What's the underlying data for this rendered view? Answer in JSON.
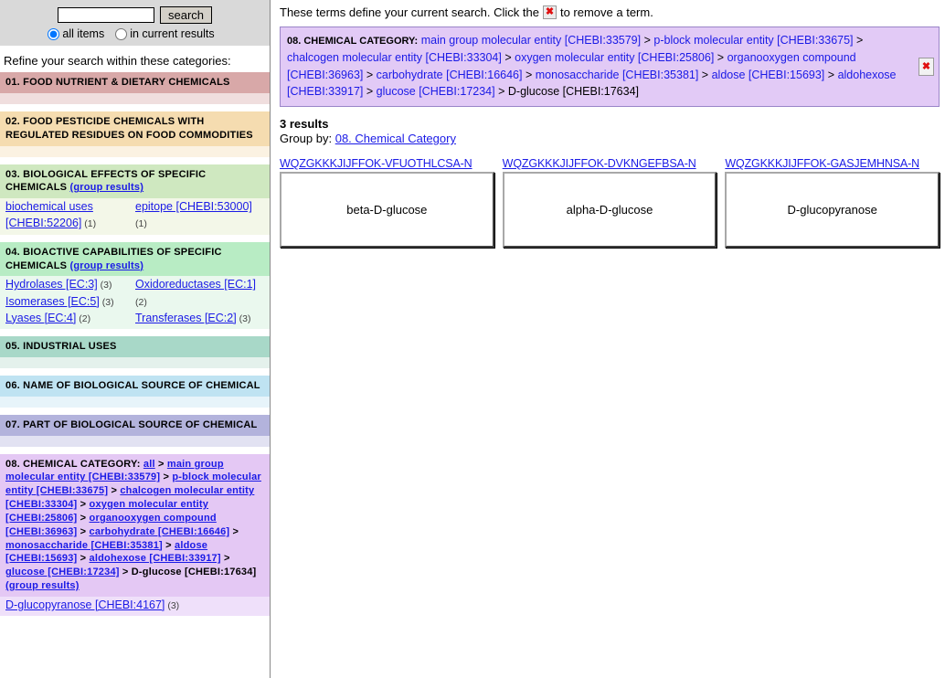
{
  "search": {
    "input_value": "",
    "input_placeholder": "",
    "button_label": "search",
    "scope_all_label": "all items",
    "scope_current_label": "in current results",
    "selected_scope": "all items"
  },
  "refine": {
    "title": "Refine your search within these categories:"
  },
  "categories": [
    {
      "id": "c01",
      "head": "01. FOOD NUTRIENT & DIETARY CHEMICALS",
      "group_link": "",
      "items": []
    },
    {
      "id": "c02",
      "head": "02. FOOD PESTICIDE CHEMICALS WITH REGULATED RESIDUES ON FOOD COMMODITIES",
      "group_link": "",
      "items": []
    },
    {
      "id": "c03",
      "head": "03. BIOLOGICAL EFFECTS OF SPECIFIC CHEMICALS",
      "group_link": "(group results)",
      "items": [
        {
          "label": "biochemical uses [CHEBI:52206]",
          "count": "(1)"
        },
        {
          "label": "epitope [CHEBI:53000]",
          "count": "(1)"
        }
      ]
    },
    {
      "id": "c04",
      "head": "04. BIOACTIVE CAPABILITIES OF SPECIFIC CHEMICALS",
      "group_link": "(group results)",
      "items": [
        {
          "label": "Hydrolases [EC:3]",
          "count": "(3)"
        },
        {
          "label": "Oxidoreductases [EC:1]",
          "count": "(2)"
        },
        {
          "label": "Isomerases [EC:5]",
          "count": "(3)"
        },
        {
          "label": "Transferases [EC:2]",
          "count": "(3)"
        },
        {
          "label": "Lyases [EC:4]",
          "count": "(2)"
        }
      ]
    },
    {
      "id": "c05",
      "head": "05. INDUSTRIAL USES",
      "group_link": "",
      "items": []
    },
    {
      "id": "c06",
      "head": "06. NAME OF BIOLOGICAL SOURCE OF CHEMICAL",
      "group_link": "",
      "items": []
    },
    {
      "id": "c07",
      "head": "07. PART OF BIOLOGICAL SOURCE OF CHEMICAL",
      "group_link": "",
      "items": []
    }
  ],
  "chemical_category": {
    "head_label": "08. CHEMICAL CATEGORY",
    "all_label": "all",
    "path": [
      "main group molecular entity [CHEBI:33579]",
      "p-block molecular entity [CHEBI:33675]",
      "chalcogen molecular entity [CHEBI:33304]",
      "oxygen molecular entity [CHEBI:25806]",
      "organooxygen compound [CHEBI:36963]",
      "carbohydrate [CHEBI:16646]",
      "monosaccharide [CHEBI:35381]",
      "aldose [CHEBI:15693]",
      "aldohexose [CHEBI:33917]",
      "glucose [CHEBI:17234]"
    ],
    "current": "D-glucose [CHEBI:17634]",
    "group_link": "(group results)",
    "children": [
      {
        "label": "D-glucopyranose [CHEBI:4167]",
        "count": "(3)"
      }
    ]
  },
  "main": {
    "hint_before": "These terms define your current search. Click the",
    "hint_after": "to remove a term.",
    "remove_glyph": "✖",
    "term_label": "08. CHEMICAL CATEGORY:",
    "term_path": [
      "main group molecular entity [CHEBI:33579]",
      "p-block molecular entity [CHEBI:33675]",
      "chalcogen molecular entity [CHEBI:33304]",
      "oxygen molecular entity [CHEBI:25806]",
      "organooxygen compound [CHEBI:36963]",
      "carbohydrate [CHEBI:16646]",
      "monosaccharide [CHEBI:35381]",
      "aldose [CHEBI:15693]",
      "aldohexose [CHEBI:33917]",
      "glucose [CHEBI:17234]"
    ],
    "term_current": "D-glucose [CHEBI:17634]",
    "results_count": "3 results",
    "group_by_label": "Group by:",
    "group_by_value": "08. Chemical Category",
    "results": [
      {
        "key": "WQZGKKKJIJFFOK-VFUOTHLCSA-N",
        "name": "beta-D-glucose"
      },
      {
        "key": "WQZGKKKJIJFFOK-DVKNGEFBSA-N",
        "name": "alpha-D-glucose"
      },
      {
        "key": "WQZGKKKJIJFFOK-GASJEMHNSA-N",
        "name": "D-glucopyranose"
      }
    ]
  },
  "colors": {
    "link": "#1a1ae6",
    "term_box_bg": "#e2caf6",
    "remove_x": "#e01010"
  }
}
